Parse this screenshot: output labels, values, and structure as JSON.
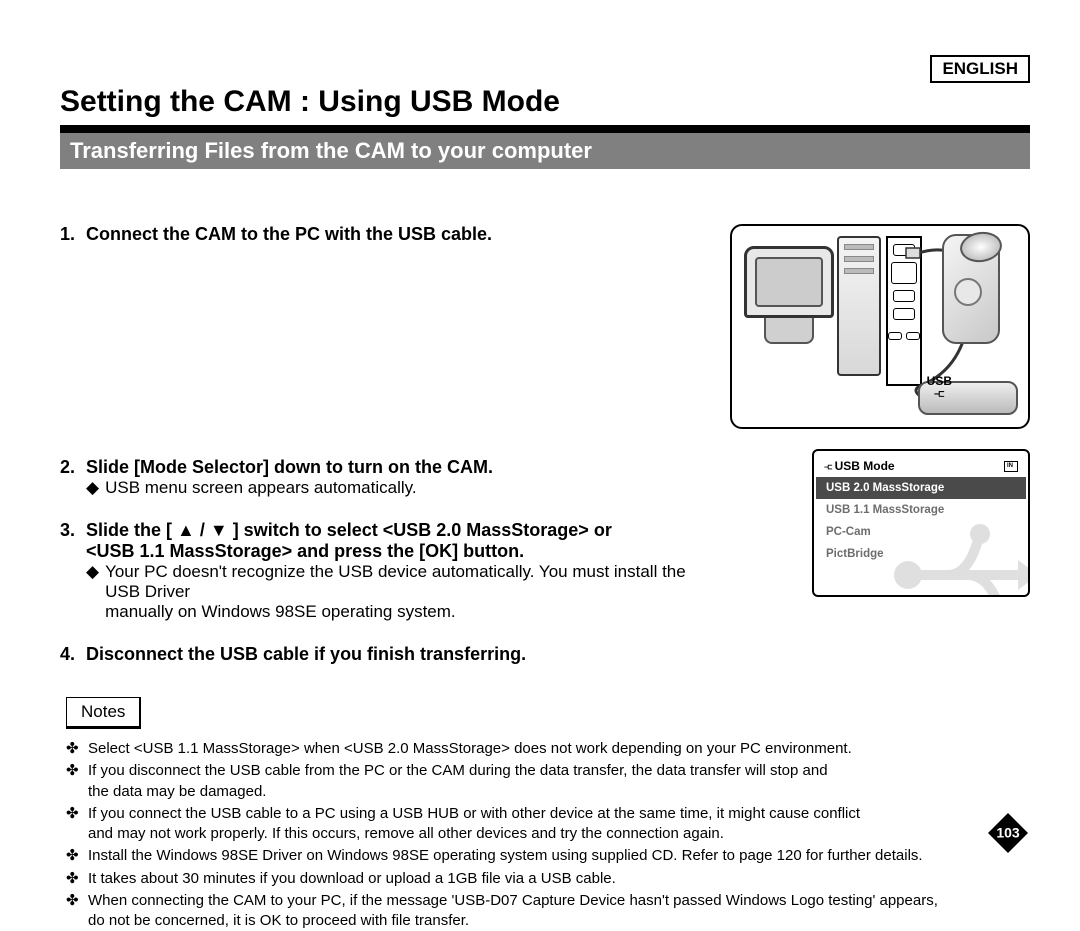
{
  "language_label": "ENGLISH",
  "main_title": "Setting the CAM : Using USB Mode",
  "section_title": "Transferring Files from the CAM to your computer",
  "steps": [
    {
      "num": "1.",
      "text": "Connect the CAM to the PC with the USB cable."
    },
    {
      "num": "2.",
      "text": "Slide [Mode Selector] down to turn on the CAM.",
      "sub1_prefix": "◆",
      "sub1": "USB menu screen appears automatically."
    },
    {
      "num": "3.",
      "text_part1": "Slide the [ ",
      "text_part2": " / ",
      "text_part3": " ] switch to select <USB 2.0 MassStorage> or",
      "text_line2": "<USB 1.1 MassStorage> and press the [OK] button.",
      "sub1_prefix": "◆",
      "sub1": "Your PC doesn't recognize the USB device automatically. You must install the USB Driver",
      "sub1_line2": "manually on Windows 98SE operating system."
    },
    {
      "num": "4.",
      "text": "Disconnect the USB cable if you finish transferring."
    }
  ],
  "notes_label": "Notes",
  "notes": [
    {
      "b": "✤",
      "t": "Select <USB 1.1 MassStorage> when <USB 2.0 MassStorage> does not work depending on your PC environment."
    },
    {
      "b": "✤",
      "t": "If you disconnect the USB cable from the PC or the CAM during the data transfer, the data transfer will stop and",
      "t2": "the data may be damaged."
    },
    {
      "b": "✤",
      "t": "If you connect the USB cable to a PC using a USB HUB or with other device at the same time, it might cause conflict",
      "t2": "and may not work properly. If this occurs, remove all other devices and try the connection again."
    },
    {
      "b": "✤",
      "t": "Install the Windows 98SE Driver on Windows 98SE operating system using supplied CD. Refer to page 120 for further details."
    },
    {
      "b": "✤",
      "t": "It takes about 30 minutes if you download or upload a 1GB file via a USB cable."
    },
    {
      "b": "✤",
      "t": "When connecting the CAM to your PC, if the message 'USB-D07 Capture Device hasn't passed Windows Logo testing' appears,",
      "t2": "do not be concerned, it is OK to proceed with file transfer."
    }
  ],
  "illustration": {
    "usb_label": "USB"
  },
  "lcd": {
    "title": "USB Mode",
    "items": [
      "USB 2.0 MassStorage",
      "USB 1.1 MassStorage",
      "PC-Cam",
      "PictBridge"
    ],
    "selected_index": 0
  },
  "page_number": "103"
}
